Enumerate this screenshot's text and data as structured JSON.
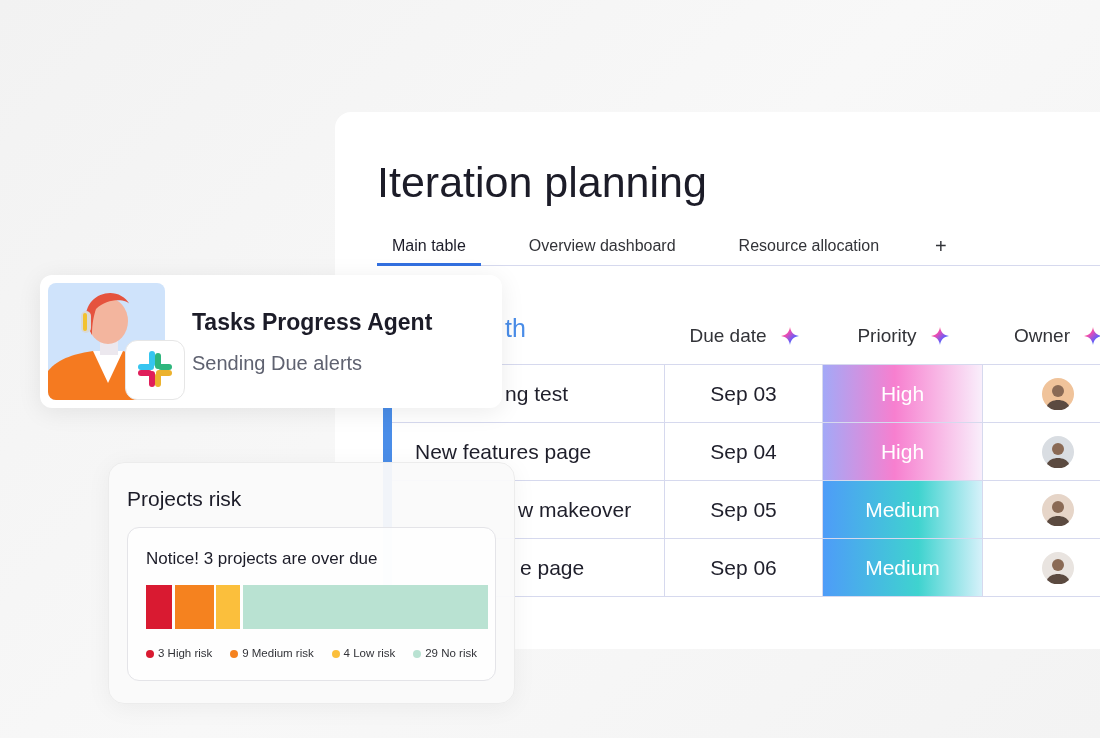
{
  "board": {
    "title": "Iteration planning",
    "tabs": [
      {
        "label": "Main table",
        "selected": true
      },
      {
        "label": "Overview dashboard",
        "selected": false
      },
      {
        "label": "Resource allocation",
        "selected": false
      }
    ],
    "add_tab": "+",
    "table": {
      "group_title": "th",
      "columns": [
        "Due date",
        "Priority",
        "Owner"
      ],
      "rows": [
        {
          "task": "ng test",
          "due": "Sep 03",
          "priority": {
            "label": "High",
            "kind": "high"
          }
        },
        {
          "task": "New features page",
          "due": "Sep 04",
          "priority": {
            "label": "High",
            "kind": "high"
          }
        },
        {
          "task": "w makeover",
          "due": "Sep 05",
          "priority": {
            "label": "Medium",
            "kind": "medium"
          }
        },
        {
          "task": "e page",
          "due": "Sep 06",
          "priority": {
            "label": "Medium",
            "kind": "medium"
          }
        }
      ]
    }
  },
  "agent_card": {
    "title": "Tasks Progress Agent",
    "status": "Sending Due alerts"
  },
  "risk_card": {
    "title": "Projects risk",
    "notice": "Notice! 3 projects are over due",
    "segments": [
      {
        "label": "3 High risk",
        "color": "#d91a31"
      },
      {
        "label": "9 Medium risk",
        "color": "#f5821f"
      },
      {
        "label": "4 Low risk",
        "color": "#fbbf3c"
      },
      {
        "label": "29 No risk",
        "color": "#b9e2d2"
      }
    ]
  }
}
